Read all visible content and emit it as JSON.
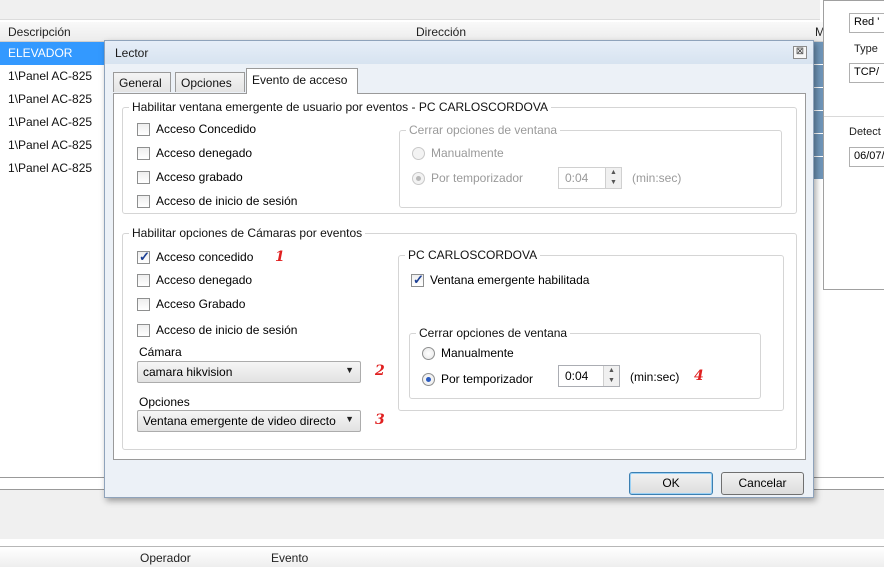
{
  "background": {
    "columns": {
      "descripcion": "Descripción",
      "direccion": "Dirección",
      "m": "M"
    },
    "rows": [
      {
        "label": "ELEVADOR",
        "selected": true
      },
      {
        "label": "1\\Panel AC-825",
        "selected": false
      },
      {
        "label": "1\\Panel AC-825",
        "selected": false
      },
      {
        "label": "1\\Panel AC-825",
        "selected": false
      },
      {
        "label": "1\\Panel AC-825",
        "selected": false
      },
      {
        "label": "1\\Panel AC-825",
        "selected": false
      }
    ],
    "footer_columns": {
      "operador": "Operador",
      "evento": "Evento"
    },
    "side_panel": {
      "red": "Red '",
      "type_label": "Type",
      "tcp": "TCP/",
      "detect": "Detect",
      "date": "06/07/"
    }
  },
  "dialog": {
    "title": "Lector",
    "close_glyph": "⊠",
    "tabs": [
      {
        "label": "General",
        "active": false
      },
      {
        "label": "Opciones",
        "active": false
      },
      {
        "label": "Evento de acceso",
        "active": true
      }
    ],
    "popup_group": {
      "title": "Habilitar ventana emergente de usuario por eventos - PC CARLOSCORDOVA",
      "checks": [
        {
          "label": "Acceso Concedido",
          "checked": false
        },
        {
          "label": "Acceso denegado",
          "checked": false
        },
        {
          "label": "Acceso grabado",
          "checked": false
        },
        {
          "label": "Acceso de inicio de sesión",
          "checked": false
        }
      ],
      "close_options": {
        "title": "Cerrar opciones de ventana",
        "manual": "Manualmente",
        "timer": "Por temporizador",
        "time": "0:04",
        "unit": "(min:sec)"
      }
    },
    "camera_group": {
      "title": "Habilitar opciones de Cámaras por eventos",
      "checks": [
        {
          "label": "Acceso concedido",
          "checked": true
        },
        {
          "label": "Acceso denegado",
          "checked": false
        },
        {
          "label": "Acceso Grabado",
          "checked": false
        },
        {
          "label": "Acceso de inicio de sesión",
          "checked": false
        }
      ],
      "camera_label": "Cámara",
      "camera_value": "camara hikvision",
      "options_label": "Opciones",
      "options_value": "Ventana emergente de video directo",
      "pc_group": {
        "title": "PC CARLOSCORDOVA",
        "popup_enabled": "Ventana emergente habilitada",
        "close_options": {
          "title": "Cerrar opciones de ventana",
          "manual": "Manualmente",
          "timer": "Por temporizador",
          "time": "0:04",
          "unit": "(min:sec)"
        }
      }
    },
    "annotations": {
      "one": "1",
      "two": "2",
      "three": "3",
      "four": "4"
    },
    "ok": "OK",
    "cancel": "Cancelar"
  }
}
